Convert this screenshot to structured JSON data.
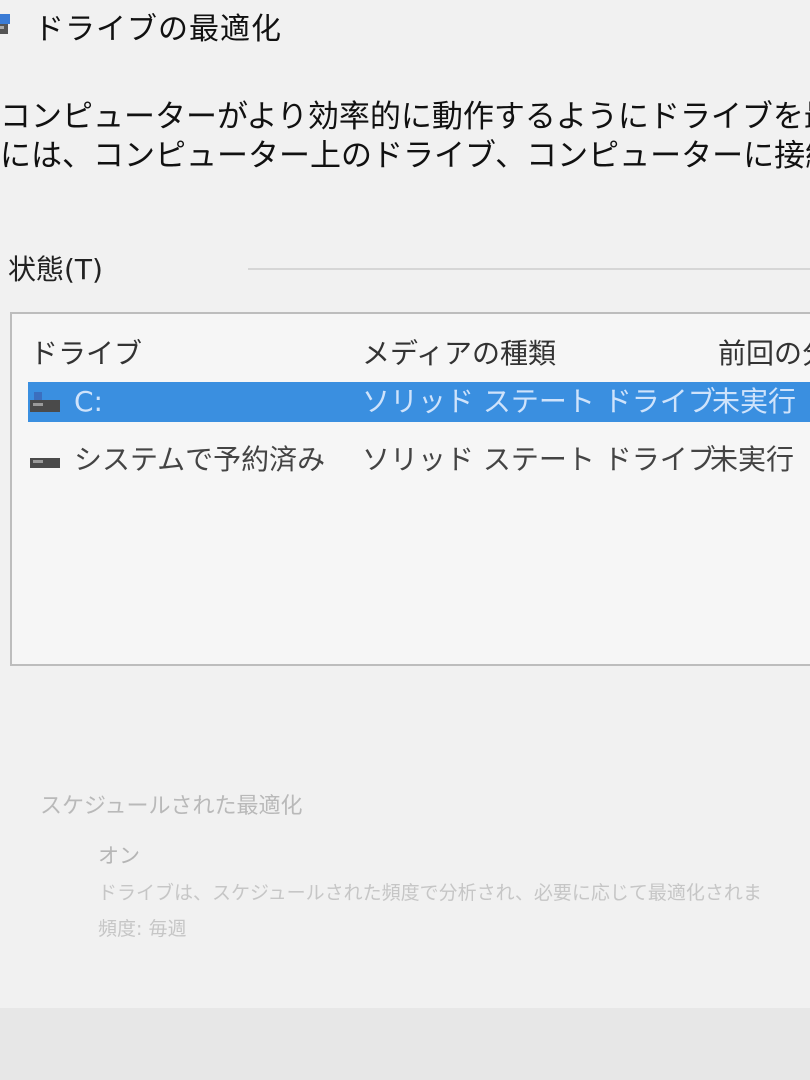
{
  "window": {
    "title": "ドライブの最適化",
    "icon": "defrag-app-icon"
  },
  "description": {
    "line1": "コンピューターがより効率的に動作するようにドライブを最適化したり、ド",
    "line2": "には、コンピューター上のドライブ、コンピューターに接続されているドライブ"
  },
  "status": {
    "label": "状態(T)"
  },
  "table": {
    "columns": [
      "ドライブ",
      "メディアの種類",
      "前回の分"
    ],
    "rows": [
      {
        "drive": "C:",
        "media": "ソリッド ステート ドライブ",
        "last": "未実行",
        "selected": true
      },
      {
        "drive": "システムで予約済み",
        "media": "ソリッド ステート ドライブ",
        "last": "未実行",
        "selected": false
      }
    ]
  },
  "schedule": {
    "title": "スケジュールされた最適化",
    "state": "オン",
    "description": "ドライブは、スケジュールされた頻度で分析され、必要に応じて最適化されま",
    "frequency": "頻度: 毎週"
  },
  "colors": {
    "selection": "#3a8fe0",
    "background": "#f1f1f1"
  }
}
